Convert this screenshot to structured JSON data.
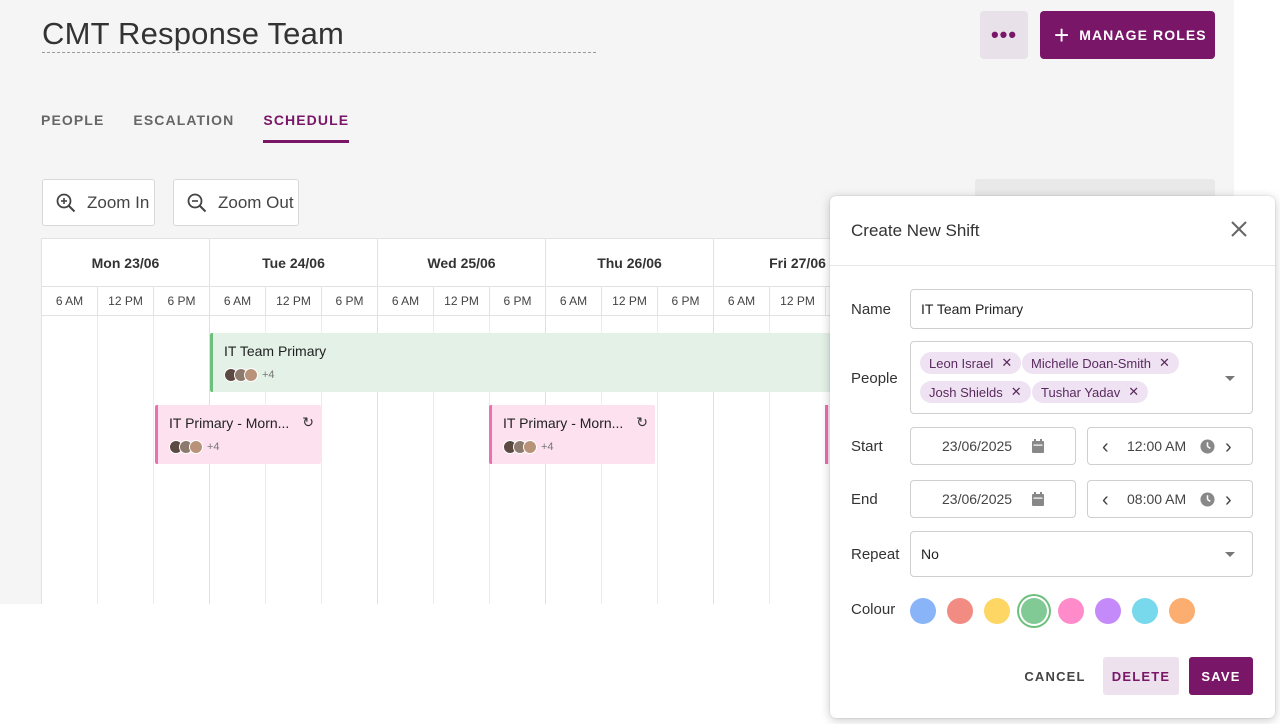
{
  "header": {
    "title": "CMT Response Team",
    "more_label": "•••",
    "manage_roles_label": "MANAGE ROLES"
  },
  "tabs": [
    {
      "label": "PEOPLE",
      "active": false
    },
    {
      "label": "ESCALATION",
      "active": false
    },
    {
      "label": "SCHEDULE",
      "active": true
    }
  ],
  "toolbar": {
    "zoom_in_label": "Zoom In",
    "zoom_out_label": "Zoom Out"
  },
  "calendar": {
    "days": [
      "Mon 23/06",
      "Tue 24/06",
      "Wed 25/06",
      "Thu 26/06",
      "Fri 27/06"
    ],
    "hours": [
      "6 AM",
      "12 PM",
      "6 PM"
    ],
    "shifts": [
      {
        "title": "IT Team Primary",
        "extra_count": "+4",
        "color": "#6dbf7c"
      },
      {
        "title": "IT Primary - Morn...",
        "extra_count": "+4",
        "color": "#ec6fb0"
      },
      {
        "title": "IT Primary - Morn...",
        "extra_count": "+4",
        "color": "#ec6fb0"
      }
    ]
  },
  "modal": {
    "title": "Create New Shift",
    "name_label": "Name",
    "name_value": "IT Team Primary",
    "people_label": "People",
    "people": [
      "Leon Israel",
      "Michelle Doan-Smith",
      "Josh Shields",
      "Tushar Yadav"
    ],
    "start_label": "Start",
    "start_date": "23/06/2025",
    "start_time": "12:00 AM",
    "end_label": "End",
    "end_date": "23/06/2025",
    "end_time": "08:00 AM",
    "repeat_label": "Repeat",
    "repeat_value": "No",
    "colour_label": "Colour",
    "colours": [
      "#8ab4f8",
      "#f28b82",
      "#fdd663",
      "#81c995",
      "#ff8bcb",
      "#c58af9",
      "#78d9ec",
      "#fcad70"
    ],
    "selected_colour": "#81c995",
    "cancel_label": "CANCEL",
    "delete_label": "DELETE",
    "save_label": "SAVE"
  },
  "accent_color": "#7a1668"
}
